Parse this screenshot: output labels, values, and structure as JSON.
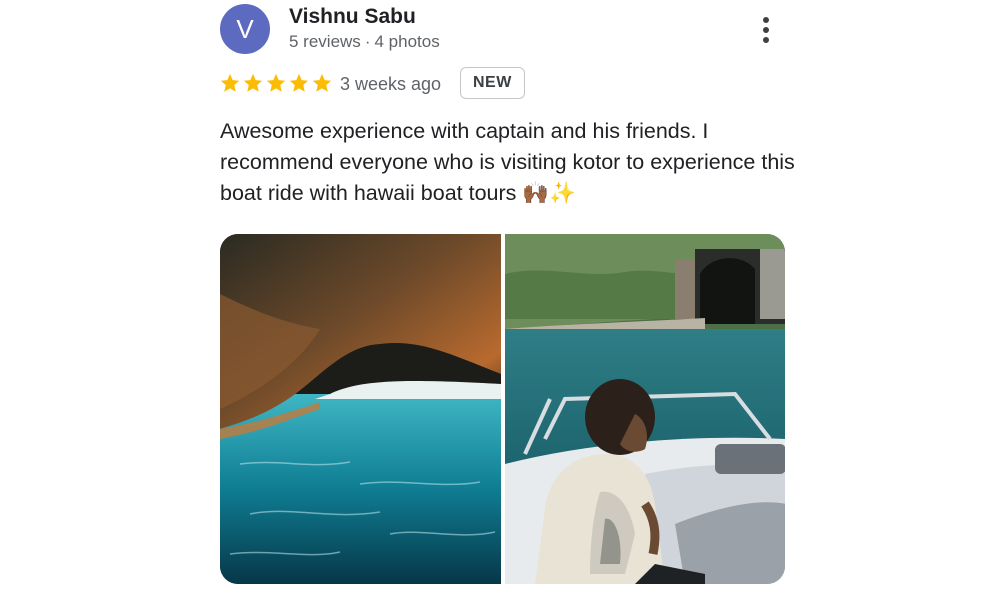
{
  "reviewer": {
    "initial": "V",
    "name": "Vishnu Sabu",
    "reviews": "5 reviews",
    "separator": "·",
    "photos": "4 photos",
    "avatar_color": "#5c6bc0"
  },
  "rating": {
    "stars": 5,
    "max": 5,
    "color": "#fbbc04"
  },
  "time_ago": "3 weeks ago",
  "badge": "NEW",
  "review_text": "Awesome experience with captain and his friends. I recommend everyone who is visiting kotor to experience this boat ride with hawaii boat tours 🙌🏾✨",
  "menu_icon": "more-vert-icon",
  "photos": [
    {
      "subject": "sea cave with turquoise water"
    },
    {
      "subject": "boy sitting on boat near tunnel"
    }
  ]
}
